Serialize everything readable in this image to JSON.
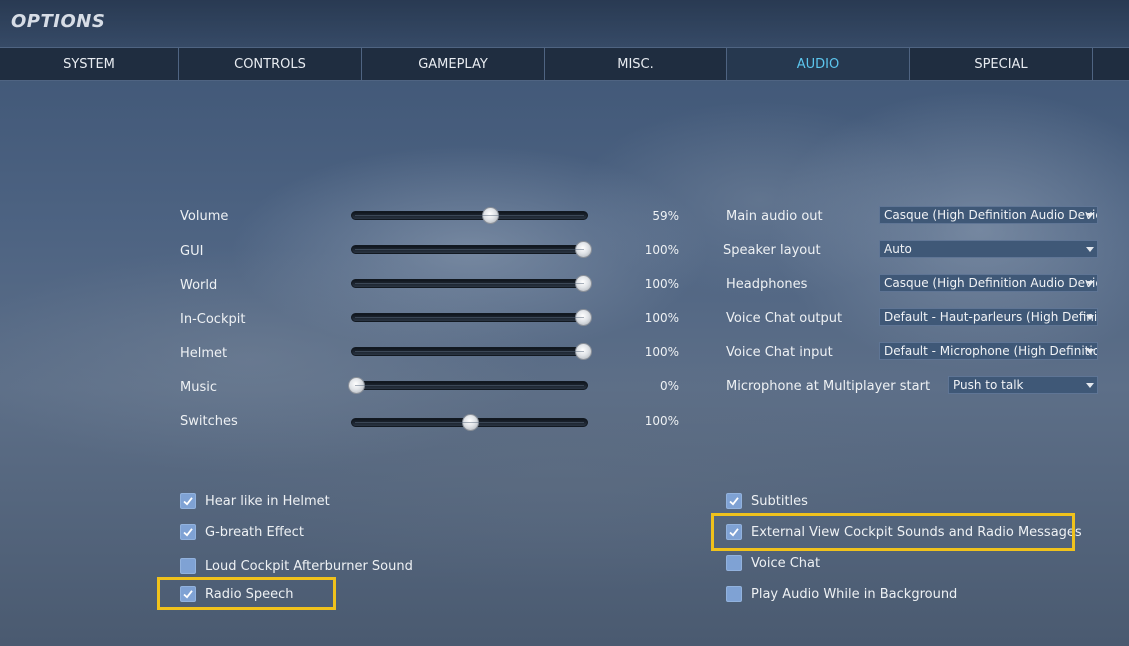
{
  "window": {
    "title": "OPTIONS"
  },
  "tabs": [
    {
      "label": "SYSTEM",
      "active": false
    },
    {
      "label": "CONTROLS",
      "active": false
    },
    {
      "label": "GAMEPLAY",
      "active": false
    },
    {
      "label": "MISC.",
      "active": false
    },
    {
      "label": "AUDIO",
      "active": true
    },
    {
      "label": "SPECIAL",
      "active": false
    }
  ],
  "sliders": [
    {
      "label": "Volume",
      "value_text": "59%",
      "fraction": 0.59
    },
    {
      "label": "GUI",
      "value_text": "100%",
      "fraction": 1.0
    },
    {
      "label": "World",
      "value_text": "100%",
      "fraction": 1.0
    },
    {
      "label": "In-Cockpit",
      "value_text": "100%",
      "fraction": 1.0
    },
    {
      "label": "Helmet",
      "value_text": "100%",
      "fraction": 1.0
    },
    {
      "label": "Music",
      "value_text": "0%",
      "fraction": 0.0
    },
    {
      "label": "Switches",
      "value_text": "100%",
      "fraction": 0.5
    }
  ],
  "dropdowns": [
    {
      "label": "Main audio out",
      "value": "Casque (High Definition Audio Device)"
    },
    {
      "label": "Speaker layout",
      "value": "Auto"
    },
    {
      "label": "Headphones",
      "value": "Casque (High Definition Audio Device)"
    },
    {
      "label": "Voice Chat output",
      "value": "Default - Haut-parleurs (High Definition Audio Device)"
    },
    {
      "label": "Voice Chat input",
      "value": "Default - Microphone (High Definition Audio Device)"
    },
    {
      "label": "Microphone at Multiplayer start",
      "value": "Push to talk"
    }
  ],
  "checkboxes_left": [
    {
      "label": "Hear like in Helmet",
      "checked": true
    },
    {
      "label": "G-breath Effect",
      "checked": true
    },
    {
      "label": "Loud Cockpit Afterburner Sound",
      "checked": false
    },
    {
      "label": "Radio Speech",
      "checked": true
    }
  ],
  "checkboxes_right": [
    {
      "label": "Subtitles",
      "checked": true
    },
    {
      "label": "External View Cockpit Sounds and Radio Messages",
      "checked": true
    },
    {
      "label": "Voice Chat",
      "checked": false
    },
    {
      "label": "Play Audio While in Background",
      "checked": false
    }
  ],
  "colors": {
    "accent_tab": "#5cc6ee",
    "highlight": "#f0c21c",
    "checkbox": "#7fa2d4"
  }
}
